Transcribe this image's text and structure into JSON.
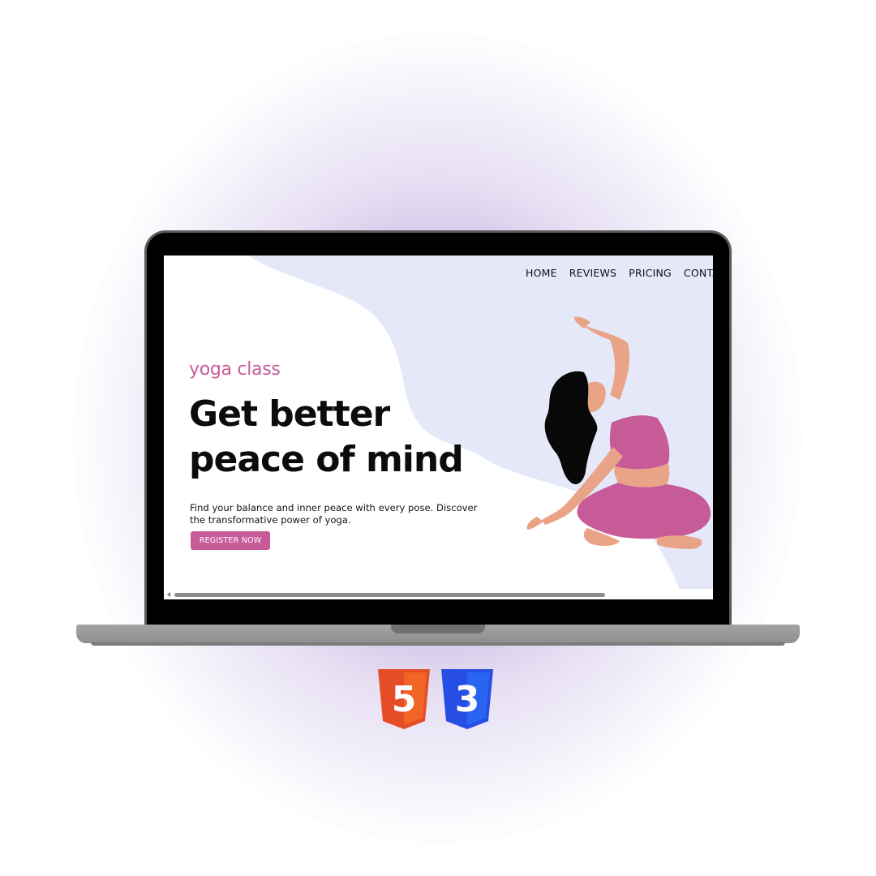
{
  "site": {
    "nav": {
      "items": [
        {
          "label": "HOME"
        },
        {
          "label": "REVIEWS"
        },
        {
          "label": "PRICING"
        },
        {
          "label": "CONTACT"
        }
      ]
    },
    "hero": {
      "eyebrow": "yoga class",
      "headline_line1": "Get better",
      "headline_line2": "peace of mind",
      "description": "Find your balance and inner peace with every pose. Discover the transformative power of yoga.",
      "cta_label": "REGISTER NOW"
    }
  },
  "badges": {
    "html5_numeral": "5",
    "css3_numeral": "3"
  },
  "colors": {
    "accent_pink": "#c75b98",
    "blob_blue": "#e4e8f8",
    "glow_purple": "#9a86cc",
    "html5_orange": "#e44d26",
    "css3_blue": "#264de4"
  }
}
